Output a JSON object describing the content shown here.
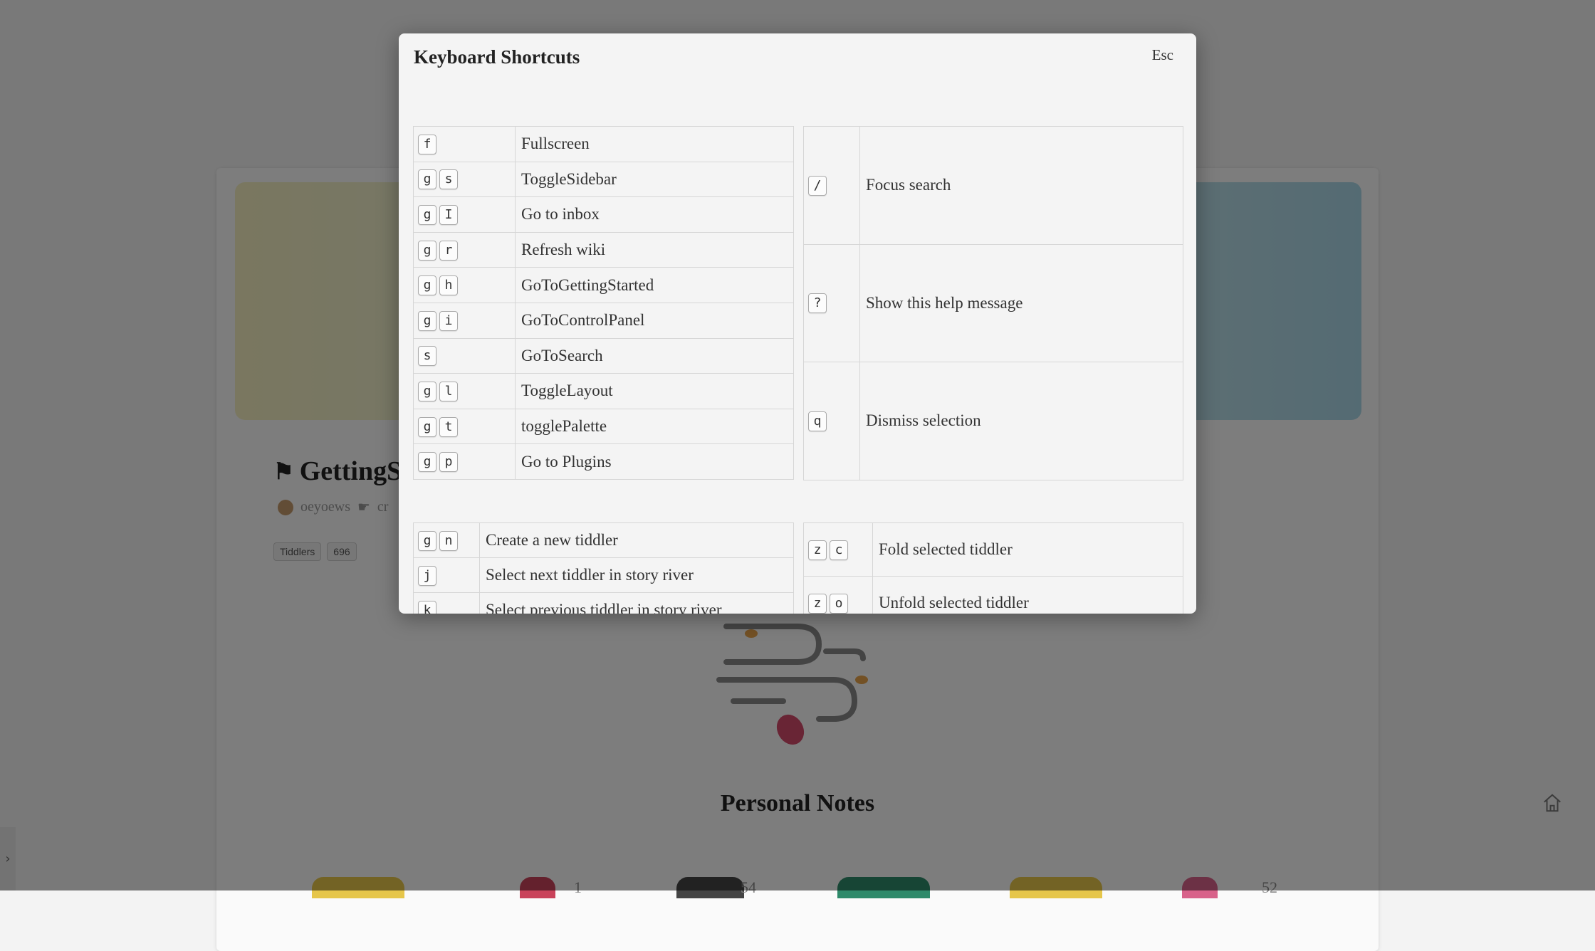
{
  "background": {
    "title": "GettingStarted",
    "author": "oeyoews",
    "meta_extra": "cr",
    "tags": [
      "Tiddlers",
      "696"
    ],
    "section_heading": "Personal Notes",
    "bottom_counts": [
      "1",
      "54",
      "52"
    ]
  },
  "modal": {
    "title": "Keyboard Shortcuts",
    "close_label": "Esc",
    "main_shortcuts": [
      {
        "keys": [
          "f"
        ],
        "label": "Fullscreen"
      },
      {
        "keys": [
          "g",
          "s"
        ],
        "label": "ToggleSidebar"
      },
      {
        "keys": [
          "g",
          "I"
        ],
        "label": "Go to inbox"
      },
      {
        "keys": [
          "g",
          "r"
        ],
        "label": "Refresh wiki"
      },
      {
        "keys": [
          "g",
          "h"
        ],
        "label": "GoToGettingStarted"
      },
      {
        "keys": [
          "g",
          "i"
        ],
        "label": "GoToControlPanel"
      },
      {
        "keys": [
          "s"
        ],
        "label": "GoToSearch"
      },
      {
        "keys": [
          "g",
          "l"
        ],
        "label": "ToggleLayout"
      },
      {
        "keys": [
          "g",
          "t"
        ],
        "label": "togglePalette"
      },
      {
        "keys": [
          "g",
          "p"
        ],
        "label": "Go to Plugins"
      }
    ],
    "side_shortcuts": [
      {
        "keys": [
          "/"
        ],
        "label": "Focus search"
      },
      {
        "keys": [
          "?"
        ],
        "label": "Show this help message"
      },
      {
        "keys": [
          "q"
        ],
        "label": "Dismiss selection"
      }
    ],
    "tiddler_shortcuts": [
      {
        "keys": [
          "g",
          "n"
        ],
        "label": "Create a new tiddler"
      },
      {
        "keys": [
          "j"
        ],
        "label": "Select next tiddler in story river"
      },
      {
        "keys": [
          "k"
        ],
        "label": "Select previous tiddler in story river"
      }
    ],
    "fold_shortcuts": [
      {
        "keys": [
          "z",
          "c"
        ],
        "label": "Fold selected tiddler"
      },
      {
        "keys": [
          "z",
          "o"
        ],
        "label": "Unfold selected tiddler"
      }
    ]
  },
  "icons": {
    "home": "home-icon",
    "sidebar_toggle": "chevron-right-icon",
    "title_icon": "flag-icon"
  }
}
